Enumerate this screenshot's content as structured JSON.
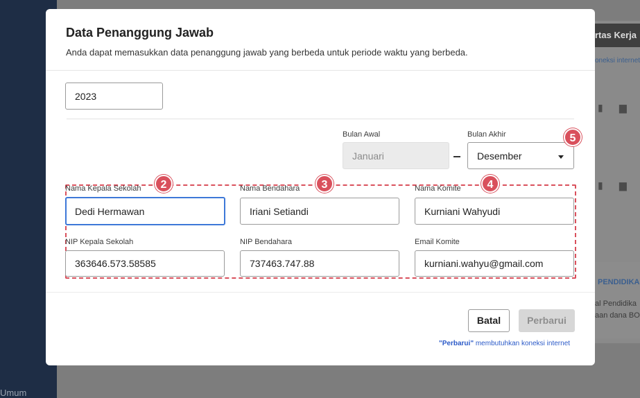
{
  "background": {
    "sidebar_label": "Umum",
    "kertas_kerja_label": "rtas Kerja",
    "koneksi_link": "oneksi internet",
    "pendidikan_label": "PENDIDIKA",
    "text_line1": "al Pendidika",
    "text_line2": "aan dana BO"
  },
  "modal": {
    "title": "Data Penanggung Jawab",
    "subtitle": "Anda dapat memasukkan data penanggung jawab yang berbeda untuk periode waktu yang berbeda.",
    "year_value": "2023",
    "bulan_awal_label": "Bulan Awal",
    "bulan_awal_value": "Januari",
    "bulan_akhir_label": "Bulan Akhir",
    "bulan_akhir_value": "Desember",
    "fields": {
      "kepala_label": "Nama Kepala Sekolah",
      "kepala_value": "Dedi Hermawan",
      "bendahara_label": "Nama Bendahara",
      "bendahara_value": "Iriani Setiandi",
      "komite_label": "Nama Komite",
      "komite_value": "Kurniani Wahyudi",
      "nip_kepala_label": "NIP Kepala Sekolah",
      "nip_kepala_value": "363646.573.58585",
      "nip_bendahara_label": "NIP Bendahara",
      "nip_bendahara_value": "737463.747.88",
      "email_komite_label": "Email Komite",
      "email_komite_value": "kurniani.wahyu@gmail.com"
    },
    "badges": [
      "2",
      "3",
      "4",
      "5"
    ],
    "batal_label": "Batal",
    "perbarui_label": "Perbarui",
    "note_quote": "\"Perbarui\"",
    "note_rest": " membutuhkan koneksi internet"
  },
  "colors": {
    "accent": "#3d78d8",
    "badge": "#d9505c",
    "link": "#2b5ac8"
  }
}
